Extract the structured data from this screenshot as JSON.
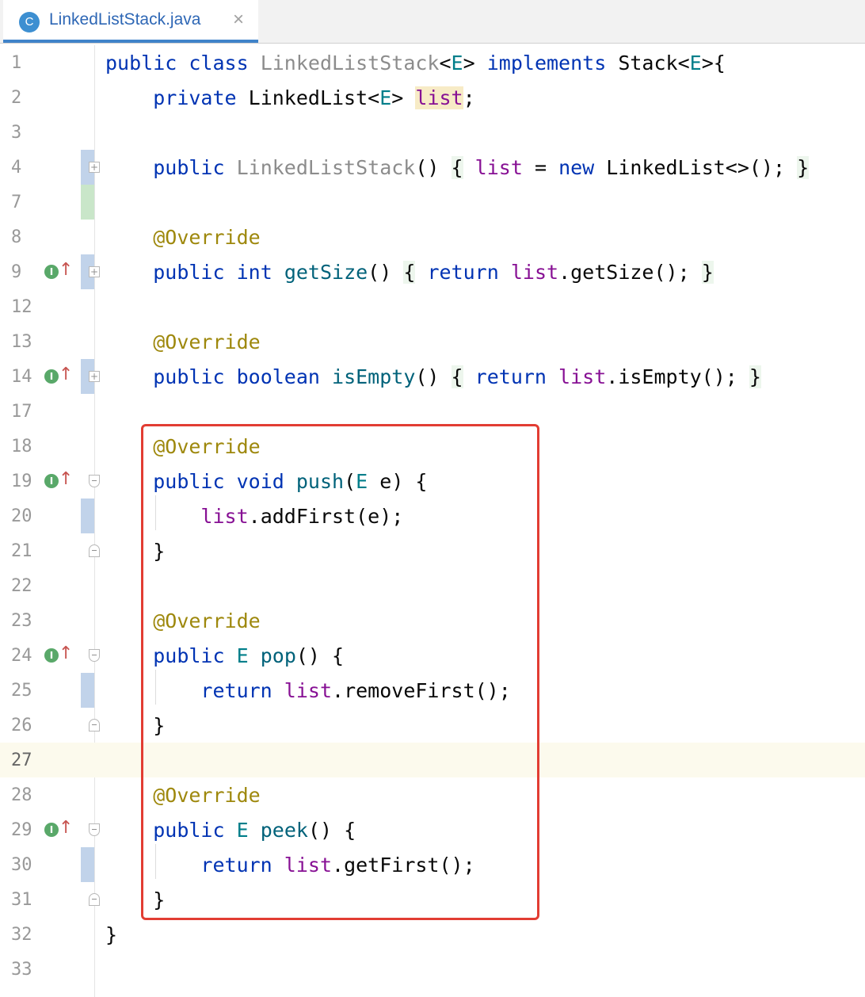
{
  "tab": {
    "icon_letter": "C",
    "title": "LinkedListStack.java",
    "close_glyph": "×"
  },
  "gutter": {
    "implements_glyph": "I",
    "up_arrow_glyph": "↑",
    "fold_plus_glyph": "+"
  },
  "lines": [
    {
      "num": "1",
      "parts": [
        "public",
        "class",
        "LinkedListStack",
        "<",
        "E",
        ">",
        "implements",
        "Stack",
        "<",
        "E",
        ">{"
      ]
    },
    {
      "num": "2",
      "parts": [
        "private",
        "LinkedList",
        "<",
        "E",
        ">",
        "list",
        ";"
      ]
    },
    {
      "num": "3"
    },
    {
      "num": "4",
      "parts": [
        "public",
        "LinkedListStack",
        "()",
        "{",
        "list",
        "=",
        "new",
        "LinkedList<>();",
        "}"
      ]
    },
    {
      "num": "7"
    },
    {
      "num": "8",
      "parts": [
        "@Override"
      ]
    },
    {
      "num": "9",
      "parts": [
        "public",
        "int",
        "getSize",
        "()",
        "{",
        "return",
        "list",
        ".getSize();",
        "}"
      ]
    },
    {
      "num": "12"
    },
    {
      "num": "13",
      "parts": [
        "@Override"
      ]
    },
    {
      "num": "14",
      "parts": [
        "public",
        "boolean",
        "isEmpty",
        "()",
        "{",
        "return",
        "list",
        ".isEmpty();",
        "}"
      ]
    },
    {
      "num": "17"
    },
    {
      "num": "18",
      "parts": [
        "@Override"
      ]
    },
    {
      "num": "19",
      "parts": [
        "public",
        "void",
        "push",
        "(",
        "E",
        "e) {"
      ]
    },
    {
      "num": "20",
      "parts": [
        "list",
        ".addFirst(e);"
      ]
    },
    {
      "num": "21",
      "parts": [
        "}"
      ]
    },
    {
      "num": "22"
    },
    {
      "num": "23",
      "parts": [
        "@Override"
      ]
    },
    {
      "num": "24",
      "parts": [
        "public",
        "E",
        "pop",
        "() {"
      ]
    },
    {
      "num": "25",
      "parts": [
        "return",
        "list",
        ".removeFirst();"
      ]
    },
    {
      "num": "26",
      "parts": [
        "}"
      ]
    },
    {
      "num": "27"
    },
    {
      "num": "28",
      "parts": [
        "@Override"
      ]
    },
    {
      "num": "29",
      "parts": [
        "public",
        "E",
        "peek",
        "() {"
      ]
    },
    {
      "num": "30",
      "parts": [
        "return",
        "list",
        ".getFirst();"
      ]
    },
    {
      "num": "31",
      "parts": [
        "}"
      ]
    },
    {
      "num": "32",
      "parts": [
        "}"
      ]
    },
    {
      "num": "33"
    }
  ],
  "colors": {
    "keyword": "#0033b3",
    "field": "#871094",
    "type_param": "#007e8a",
    "annotation": "#9e880d",
    "method": "#00627a",
    "highlight_box": "#e23d33",
    "current_line": "#fcfaed"
  }
}
